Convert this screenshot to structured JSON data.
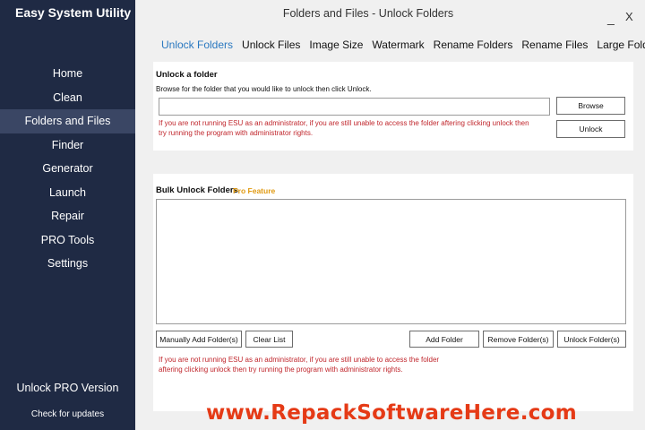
{
  "app": {
    "title": "Easy System Utility"
  },
  "sidebar": {
    "items": [
      {
        "label": "Home"
      },
      {
        "label": "Clean"
      },
      {
        "label": "Folders and Files"
      },
      {
        "label": "Finder"
      },
      {
        "label": "Generator"
      },
      {
        "label": "Launch"
      },
      {
        "label": "Repair"
      },
      {
        "label": "PRO Tools"
      },
      {
        "label": "Settings"
      }
    ],
    "unlock_pro": "Unlock PRO Version",
    "check_updates": "Check for updates"
  },
  "window": {
    "title": "Folders and Files - Unlock Folders",
    "minimize": "_",
    "close": "X"
  },
  "tabs": [
    {
      "label": "Unlock Folders"
    },
    {
      "label": "Unlock Files"
    },
    {
      "label": "Image Size"
    },
    {
      "label": "Watermark"
    },
    {
      "label": "Rename Folders"
    },
    {
      "label": "Rename Files"
    },
    {
      "label": "Large Folders"
    }
  ],
  "unlock": {
    "heading": "Unlock a folder",
    "instructions": "Browse for the folder that you would like to unlock then click Unlock.",
    "path_value": "",
    "browse_label": "Browse",
    "unlock_label": "Unlock",
    "warning_line1": "If you are not running ESU as an administrator, if you are still unable to access the folder aftering clicking unlock then",
    "warning_line2": "try running the program with administrator rights."
  },
  "bulk": {
    "heading": "Bulk Unlock Folders",
    "pro_feature": "Pro Feature",
    "manual_add_label": "Manually Add Folder(s)",
    "clear_list_label": "Clear List",
    "add_folder_label": "Add Folder",
    "remove_folder_label": "Remove Folder(s)",
    "unlock_folders_label": "Unlock Folder(s)",
    "warning_line1": "If you are not running ESU as an administrator, if you are still unable to access the folder",
    "warning_line2": "aftering clicking unlock then try running the program with administrator rights."
  },
  "watermark_text": "www.RepackSoftwareHere.com",
  "colors": {
    "sidebar_bg": "#1f2a44",
    "active_tab": "#2a78c0",
    "warning": "#c0262c",
    "pro": "#e09a12",
    "watermark": "#e53a16"
  }
}
